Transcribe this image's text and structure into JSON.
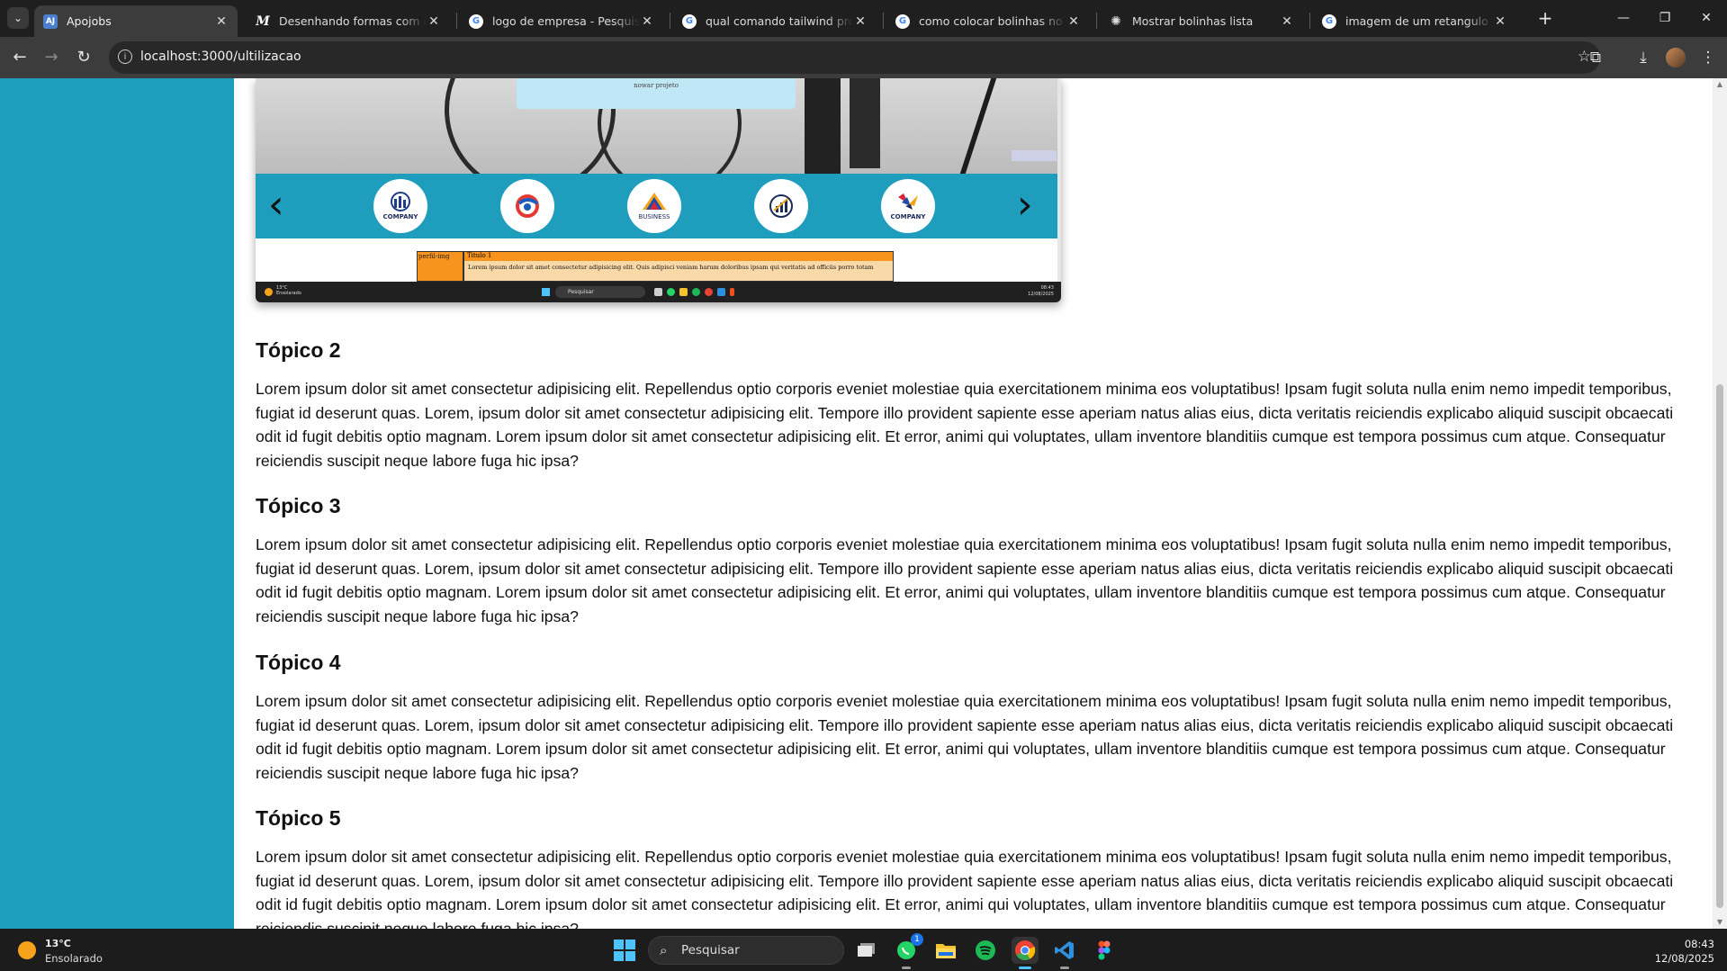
{
  "browser": {
    "tabs": [
      {
        "title": "Apojobs",
        "favicon": "app-icon",
        "active": true
      },
      {
        "title": "Desenhando formas com canvas",
        "favicon": "mdn-icon",
        "active": false
      },
      {
        "title": "logo de empresa - Pesquisa Google",
        "favicon": "google-icon",
        "active": false
      },
      {
        "title": "qual comando tailwind pro tamanho",
        "favicon": "google-icon",
        "active": false
      },
      {
        "title": "como colocar bolinhas no elemento",
        "favicon": "google-icon",
        "active": false
      },
      {
        "title": "Mostrar bolinhas lista",
        "favicon": "openai-icon",
        "active": false
      },
      {
        "title": "imagem de um retangulo solido",
        "favicon": "google-icon",
        "active": false
      }
    ],
    "url": "localhost:3000/ultilizacao"
  },
  "embedded_screenshot": {
    "card_text": "nowar projeto",
    "logos": [
      {
        "caption": "COMPANY"
      },
      {
        "caption": ""
      },
      {
        "caption": "BUSINESS"
      },
      {
        "caption": ""
      },
      {
        "caption": "COMPANY"
      }
    ],
    "perfil_alt": "perfil-img",
    "card_title": "Titulo 1",
    "card_body": "Lorem ipsum dolor sit amet consectetur adipisicing elit. Quis adipisci veniam harum doloribus ipsam qui veritatis ad officiis porro totam",
    "weather_temp": "13°C",
    "weather_desc": "Ensolarado",
    "search_placeholder": "Pesquisar",
    "time": "08:43",
    "date": "12/08/2025"
  },
  "article": {
    "topics": [
      {
        "title": "Tópico 2",
        "body": "Lorem ipsum dolor sit amet consectetur adipisicing elit. Repellendus optio corporis eveniet molestiae quia exercitationem minima eos voluptatibus! Ipsam fugit soluta nulla enim nemo impedit temporibus, fugiat id deserunt quas. Lorem, ipsum dolor sit amet consectetur adipisicing elit. Tempore illo provident sapiente esse aperiam natus alias eius, dicta veritatis reiciendis explicabo aliquid suscipit obcaecati odit id fugit debitis optio magnam. Lorem ipsum dolor sit amet consectetur adipisicing elit. Et error, animi qui voluptates, ullam inventore blanditiis cumque est tempora possimus cum atque. Consequatur reiciendis suscipit neque labore fuga hic ipsa?"
      },
      {
        "title": "Tópico 3",
        "body": "Lorem ipsum dolor sit amet consectetur adipisicing elit. Repellendus optio corporis eveniet molestiae quia exercitationem minima eos voluptatibus! Ipsam fugit soluta nulla enim nemo impedit temporibus, fugiat id deserunt quas. Lorem, ipsum dolor sit amet consectetur adipisicing elit. Tempore illo provident sapiente esse aperiam natus alias eius, dicta veritatis reiciendis explicabo aliquid suscipit obcaecati odit id fugit debitis optio magnam. Lorem ipsum dolor sit amet consectetur adipisicing elit. Et error, animi qui voluptates, ullam inventore blanditiis cumque est tempora possimus cum atque. Consequatur reiciendis suscipit neque labore fuga hic ipsa?"
      },
      {
        "title": "Tópico 4",
        "body": "Lorem ipsum dolor sit amet consectetur adipisicing elit. Repellendus optio corporis eveniet molestiae quia exercitationem minima eos voluptatibus! Ipsam fugit soluta nulla enim nemo impedit temporibus, fugiat id deserunt quas. Lorem, ipsum dolor sit amet consectetur adipisicing elit. Tempore illo provident sapiente esse aperiam natus alias eius, dicta veritatis reiciendis explicabo aliquid suscipit obcaecati odit id fugit debitis optio magnam. Lorem ipsum dolor sit amet consectetur adipisicing elit. Et error, animi qui voluptates, ullam inventore blanditiis cumque est tempora possimus cum atque. Consequatur reiciendis suscipit neque labore fuga hic ipsa?"
      },
      {
        "title": "Tópico 5",
        "body": "Lorem ipsum dolor sit amet consectetur adipisicing elit. Repellendus optio corporis eveniet molestiae quia exercitationem minima eos voluptatibus! Ipsam fugit soluta nulla enim nemo impedit temporibus, fugiat id deserunt quas. Lorem, ipsum dolor sit amet consectetur adipisicing elit. Tempore illo provident sapiente esse aperiam natus alias eius, dicta veritatis reiciendis explicabo aliquid suscipit obcaecati odit id fugit debitis optio magnam. Lorem ipsum dolor sit amet consectetur adipisicing elit. Et error, animi qui voluptates, ullam inventore blanditiis cumque est tempora possimus cum atque. Consequatur reiciendis suscipit neque labore fuga hic ipsa?"
      }
    ]
  },
  "taskbar": {
    "weather_temp": "13°C",
    "weather_desc": "Ensolarado",
    "search_placeholder": "Pesquisar",
    "time": "08:43",
    "date": "12/08/2025",
    "whatsapp_badge": "1",
    "apps": [
      "task-view-icon",
      "whatsapp-icon",
      "file-explorer-icon",
      "spotify-icon",
      "chrome-icon",
      "vscode-icon",
      "figma-icon"
    ]
  },
  "colors": {
    "sidebar": "#1f9dbd",
    "chrome_dark": "#1f1f1f",
    "chrome_toolbar": "#3c3c3c",
    "accent_orange": "#f7941d"
  }
}
